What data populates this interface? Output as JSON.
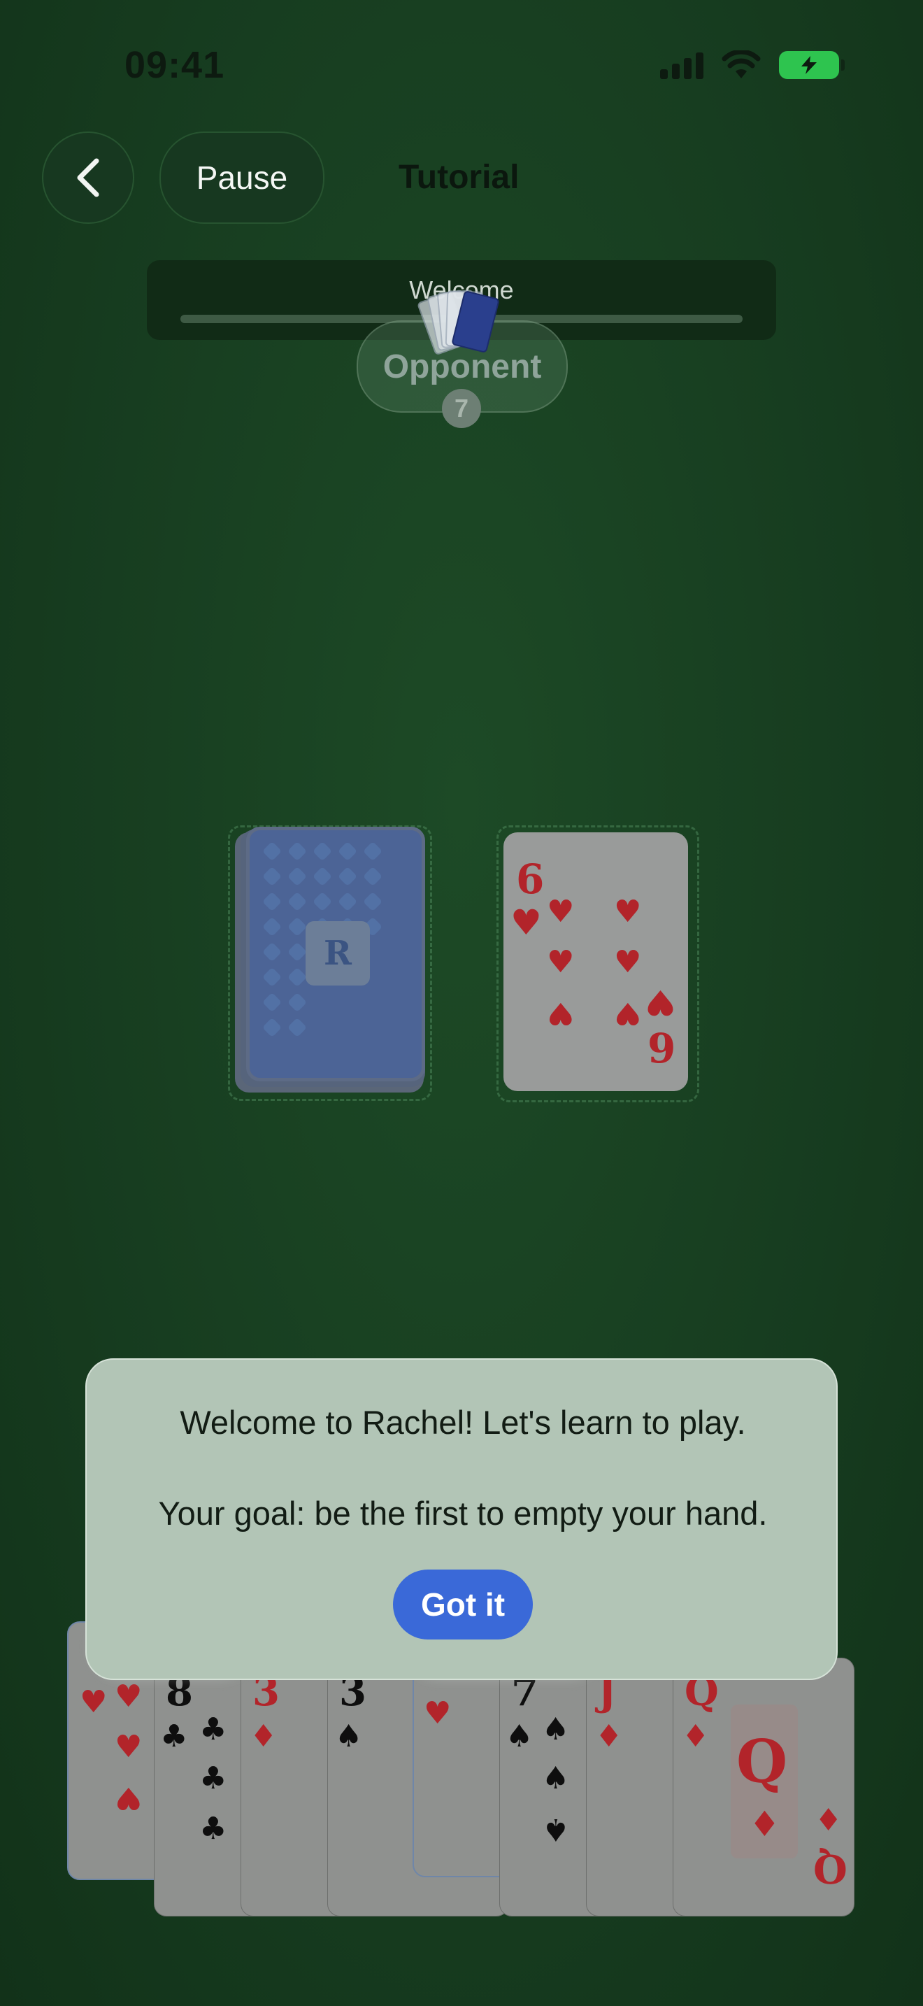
{
  "status_bar": {
    "time": "09:41",
    "signal_icon": "cellular-signal-icon",
    "wifi_icon": "wifi-icon",
    "battery_icon": "battery-charging-icon"
  },
  "header": {
    "back_icon": "chevron-left-icon",
    "pause_label": "Pause",
    "title": "Tutorial"
  },
  "progress": {
    "label": "Welcome",
    "fraction": 0.0
  },
  "opponent": {
    "label": "Opponent",
    "card_count": "7"
  },
  "deck": {
    "logo": "R"
  },
  "discard": {
    "rank": "6",
    "suit": "hearts",
    "pip": "♥",
    "rank_bottom": "9"
  },
  "hand": [
    {
      "rank": "",
      "suit": "hearts",
      "pip": "♥",
      "color": "red"
    },
    {
      "rank": "8",
      "suit": "clubs",
      "pip": "♣",
      "color": "black"
    },
    {
      "rank": "3",
      "suit": "diamonds",
      "pip": "♦",
      "color": "red"
    },
    {
      "rank": "3",
      "suit": "spades",
      "pip": "♠",
      "color": "black"
    },
    {
      "rank": "",
      "suit": "hearts",
      "pip": "♥",
      "color": "red"
    },
    {
      "rank": "7",
      "suit": "spades",
      "pip": "♠",
      "color": "black"
    },
    {
      "rank": "J",
      "suit": "diamonds",
      "pip": "♦",
      "color": "red"
    },
    {
      "rank": "Q",
      "suit": "diamonds",
      "pip": "♦",
      "color": "red",
      "rank_bottom": "Q"
    }
  ],
  "dialog": {
    "line1": "Welcome to Rachel! Let's learn to play.",
    "line2": "Your goal: be the first to empty your hand.",
    "button_label": "Got it"
  },
  "colors": {
    "table": "#173d20",
    "button_blue": "#3a69d8",
    "suit_red": "#b2242a",
    "card_back": "#4c6496"
  }
}
